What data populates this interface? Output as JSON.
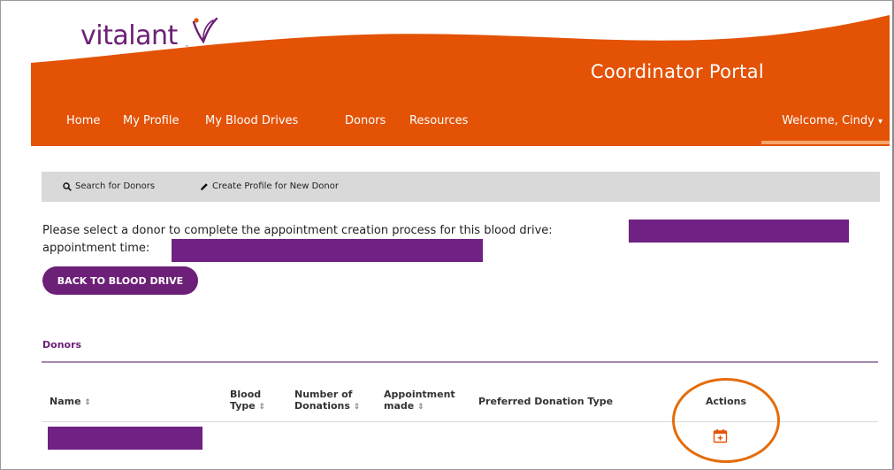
{
  "brand": {
    "logo_text": "vitalant",
    "logo_tm": "™",
    "portal_title": "Coordinator Portal",
    "orange": "#e35205",
    "purple": "#6d2077"
  },
  "nav": {
    "items": [
      "Home",
      "My Profile",
      "My Blood Drives",
      "Donors",
      "Resources"
    ],
    "welcome": "Welcome, Cindy",
    "welcome_caret": "▾"
  },
  "toolbar": {
    "search_label": "Search for Donors",
    "search_icon": "search-icon",
    "create_label": "Create Profile for New Donor",
    "create_icon": "pencil-icon"
  },
  "instruction": {
    "line1": "Please select a donor to complete the appointment creation process for this blood drive:",
    "line2": "appointment time:"
  },
  "back_button": "BACK TO BLOOD DRIVE",
  "donors": {
    "section_title": "Donors",
    "columns": [
      {
        "line1": "Name",
        "line2": ""
      },
      {
        "line1": "Blood",
        "line2": "Type"
      },
      {
        "line1": "Number of",
        "line2": "Donations"
      },
      {
        "line1": "Appointment",
        "line2": "made"
      },
      {
        "line1": "Preferred Donation Type",
        "line2": ""
      },
      {
        "line1": "Actions",
        "line2": ""
      }
    ],
    "sort_glyph": "⇕",
    "row_action_icon": "calendar-add-icon"
  }
}
